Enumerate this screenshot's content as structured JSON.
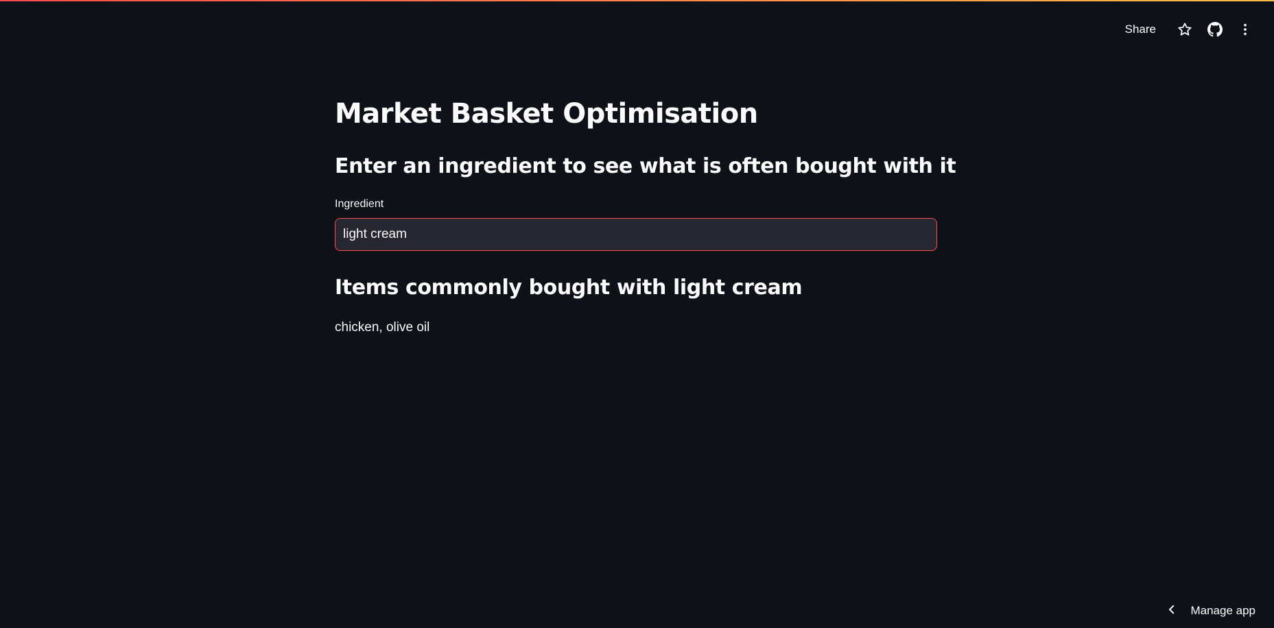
{
  "app": {
    "title": "Market Basket Optimisation",
    "subtitle": "Enter an ingredient to see what is often bought with it"
  },
  "toolbar": {
    "share_label": "Share",
    "icons": [
      "star-icon",
      "github-icon",
      "more-vertical-icon"
    ]
  },
  "ingredient_input": {
    "label": "Ingredient",
    "value": "light cream"
  },
  "results": {
    "heading": "Items commonly bought with light cream",
    "items_text": "chicken, olive oil"
  },
  "footer": {
    "manage_app_label": "Manage app",
    "icon": "chevron-left-icon"
  },
  "colors": {
    "background": "#0e1117",
    "text": "#fafafa",
    "input_background": "#262730",
    "accent": "#ff4b4b",
    "decoration_end": "#ffbd45"
  }
}
